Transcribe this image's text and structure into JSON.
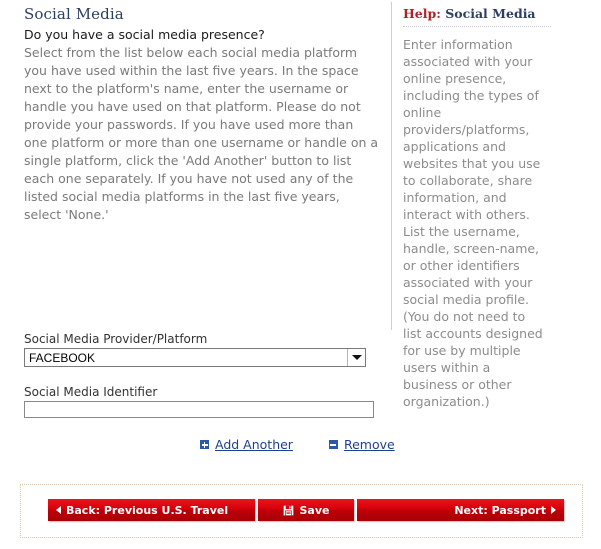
{
  "main": {
    "title": "Social Media",
    "question": "Do you have a social media presence?",
    "description": "Select from the list below each social media platform you have used within the last five years. In the space next to the platform's name, enter the username or handle you have used on that platform. Please do not provide your passwords. If you have used more than one platform or more than one username or handle on a single platform, click the 'Add Another' button to list each one separately. If you have not used any of the listed social media platforms in the last five years, select 'None.'"
  },
  "help": {
    "label": "Help:",
    "topic": "Social Media",
    "body": "Enter information associated with your online presence, including the types of online providers/platforms, applications and websites that you use to collaborate, share information, and interact with others. List the username, handle, screen-name, or other identifiers associated with your social media profile. (You do not need to list accounts designed for use by multiple users within a business or other organization.)"
  },
  "form": {
    "provider_label": "Social Media Provider/Platform",
    "provider_value": "FACEBOOK",
    "identifier_label": "Social Media Identifier",
    "identifier_value": "",
    "identifier_placeholder": ""
  },
  "actions": {
    "add_label": "Add Another",
    "add_icon": "plus-square-icon",
    "remove_label": "Remove",
    "remove_icon": "minus-square-icon"
  },
  "nav": {
    "back_label": "Back: Previous U.S. Travel",
    "save_label": "Save",
    "save_icon": "floppy-disk-icon",
    "next_label": "Next: Passport"
  },
  "colors": {
    "accent_red": "#b41f24",
    "button_red": "#d8000c",
    "heading_navy": "#2c3e63",
    "link_blue": "#1f3f8f",
    "body_gray": "#7a7a7a"
  }
}
